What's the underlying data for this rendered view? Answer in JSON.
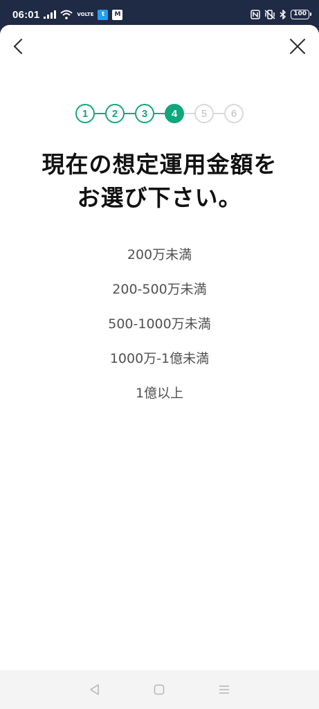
{
  "status_bar": {
    "time": "06:01",
    "volte_top": "VO",
    "volte_bottom": "LTE",
    "twitter_badge": "t",
    "mail_badge": "M",
    "nfc_label": "N",
    "battery": "100",
    "colors": {
      "background": "#1f2a44",
      "twitter": "#1da1f2",
      "mail": "#ffffff"
    }
  },
  "header": {
    "back_icon": "chevron-left-icon",
    "close_icon": "close-icon"
  },
  "stepper": {
    "accent_color": "#12a67d",
    "inactive_color": "#d8d8d8",
    "current_step": 4,
    "steps": [
      {
        "label": "1",
        "state": "done"
      },
      {
        "label": "2",
        "state": "done"
      },
      {
        "label": "3",
        "state": "done"
      },
      {
        "label": "4",
        "state": "active"
      },
      {
        "label": "5",
        "state": "todo"
      },
      {
        "label": "6",
        "state": "todo"
      }
    ]
  },
  "question": {
    "line1": "現在の想定運用金額を",
    "line2": "お選び下さい。"
  },
  "options": [
    "200万未満",
    "200-500万未満",
    "500-1000万未満",
    "1000万-1億未満",
    "1億以上"
  ],
  "nav_bar": {
    "back_icon": "triangle-back-icon",
    "home_icon": "square-home-icon",
    "menu_icon": "menu-lines-icon"
  }
}
